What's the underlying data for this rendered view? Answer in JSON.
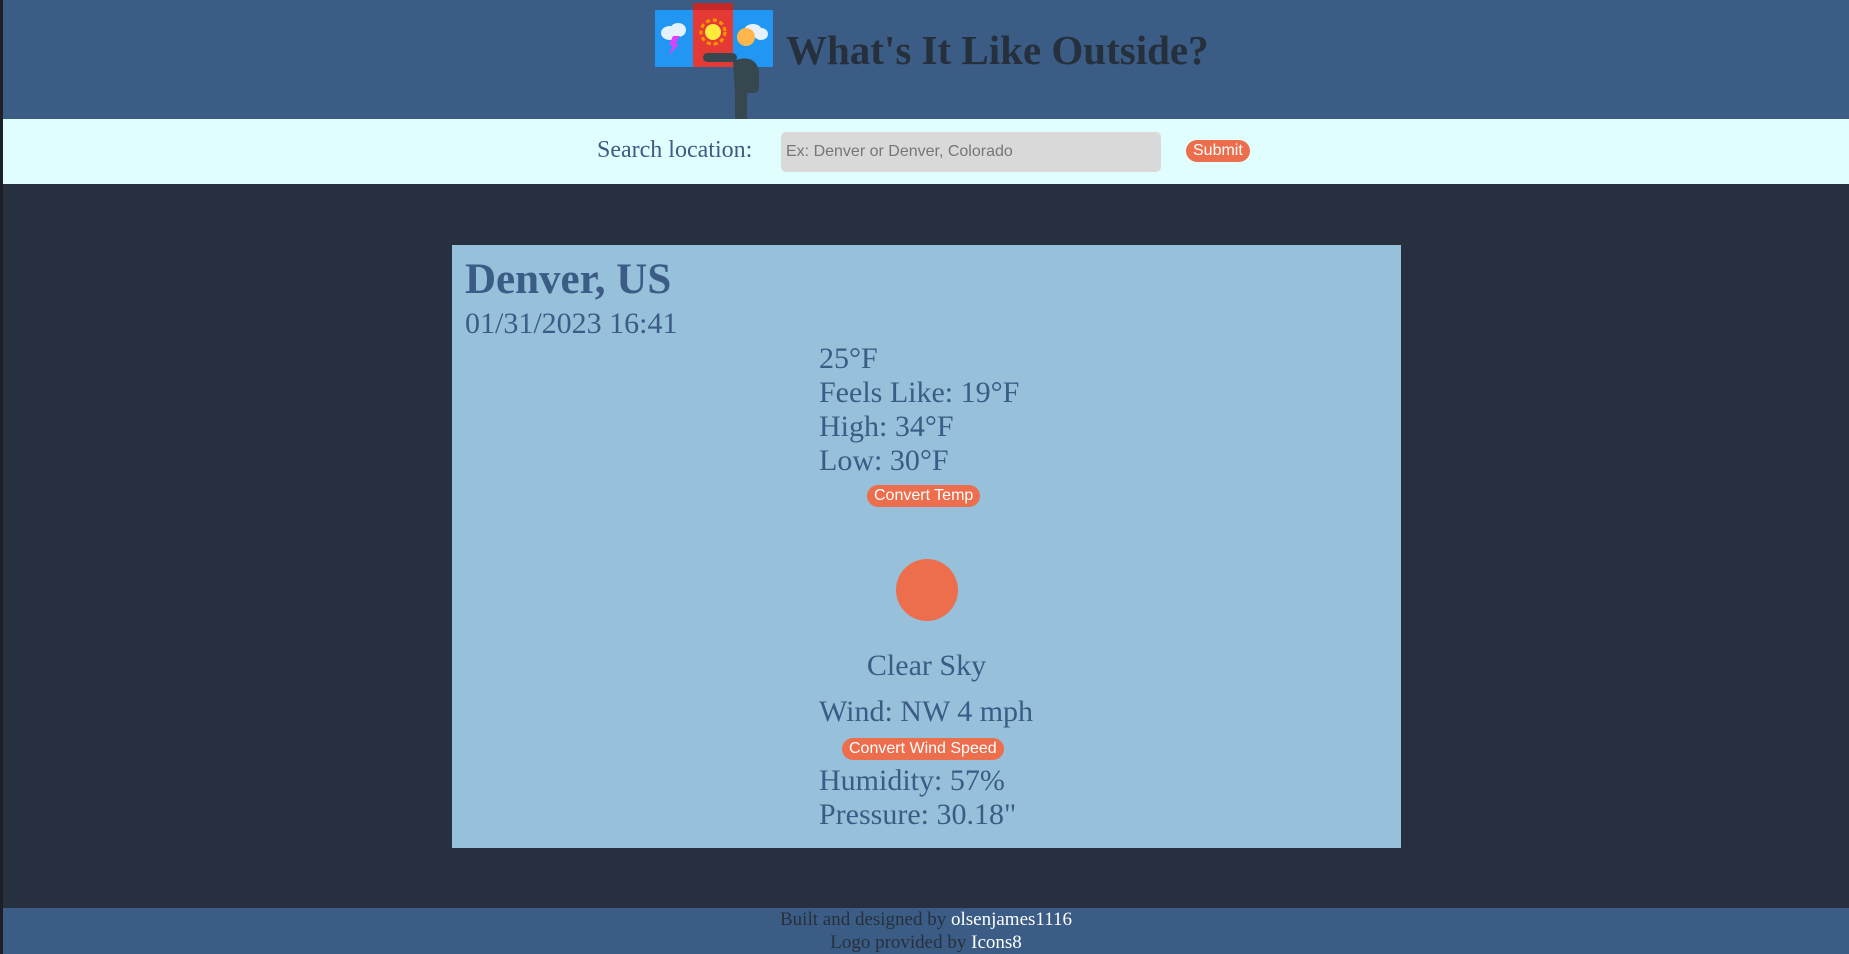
{
  "header": {
    "title": "What's It Like Outside?"
  },
  "search": {
    "label": "Search location:",
    "placeholder": "Ex: Denver or Denver, Colorado",
    "value": "",
    "submit_label": "Submit"
  },
  "weather": {
    "city": "Denver, US",
    "datetime": "01/31/2023 16:41",
    "temperature": "25°F",
    "feels_like": "Feels Like: 19°F",
    "high": "High: 34°F",
    "low": "Low: 30°F",
    "convert_temp_label": "Convert Temp",
    "condition_icon": "sun-icon",
    "condition": "Clear Sky",
    "wind": "Wind: NW 4 mph",
    "convert_wind_label": "Convert Wind Speed",
    "humidity": "Humidity: 57%",
    "pressure": "Pressure: 30.18\""
  },
  "footer": {
    "built_prefix": "Built and designed by ",
    "built_link": "olsenjames1116",
    "logo_prefix": "Logo provided by ",
    "logo_link": "Icons8"
  },
  "colors": {
    "page_background": "#27303f",
    "header_background": "#3b5c84",
    "search_background": "#e1fefe",
    "card_background": "#97c0da",
    "accent": "#ec6e4c",
    "text_primary": "#3b5c84",
    "text_dark": "#26303d"
  }
}
